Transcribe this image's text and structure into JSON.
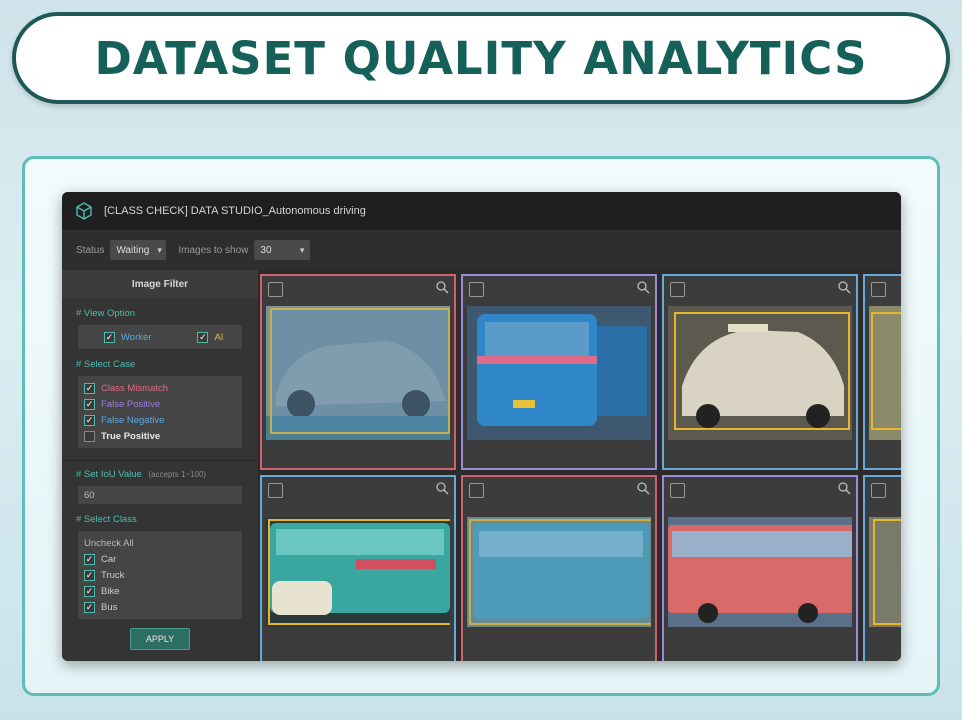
{
  "banner": {
    "title": "DATASET QUALITY ANALYTICS"
  },
  "app": {
    "title": "[CLASS CHECK] DATA STUDIO_Autonomous driving",
    "toolbar": {
      "status_label": "Status",
      "status_value": "Waiting",
      "images_label": "Images to show",
      "images_value": "30"
    },
    "sidebar": {
      "header": "Image Filter",
      "view_option_label": "# View Option",
      "view_options": [
        {
          "label": "Worker",
          "checked": true
        },
        {
          "label": "AI",
          "checked": true
        }
      ],
      "select_case_label": "# Select Case",
      "cases": [
        {
          "label": "Class Mismatch",
          "checked": true,
          "color": "#e06a8a"
        },
        {
          "label": "False Positive",
          "checked": true,
          "color": "#9b7fe0"
        },
        {
          "label": "False Negative",
          "checked": true,
          "color": "#5aa8e0"
        },
        {
          "label": "True Positive",
          "checked": false,
          "color": "#e0e0e0"
        }
      ],
      "iou_label": "# Set IoU Value",
      "iou_hint": "(accepts 1~100)",
      "iou_value": "60",
      "select_class_label": "# Select Class",
      "uncheck_all": "Uncheck All",
      "classes": [
        {
          "label": "Car",
          "checked": true
        },
        {
          "label": "Truck",
          "checked": true
        },
        {
          "label": "Bike",
          "checked": true
        },
        {
          "label": "Bus",
          "checked": true
        }
      ],
      "apply_label": "APPLY"
    },
    "grid": {
      "cells": [
        {
          "border": "#d06070",
          "subject": "car-gray"
        },
        {
          "border": "#9a8ad8",
          "subject": "bus-blue"
        },
        {
          "border": "#6aa8d8",
          "subject": "taxi-white"
        },
        {
          "border": "#6aa8d8",
          "subject": "partial"
        },
        {
          "border": "#6aa8d8",
          "subject": "bus-teal"
        },
        {
          "border": "#d06070",
          "subject": "bus-teal-2"
        },
        {
          "border": "#9a8ad8",
          "subject": "bus-red"
        },
        {
          "border": "#6aa8d8",
          "subject": "partial"
        }
      ]
    },
    "colors": {
      "accent": "#4dbdb0",
      "title": "#16605a",
      "apply": "#2d6e64"
    }
  }
}
